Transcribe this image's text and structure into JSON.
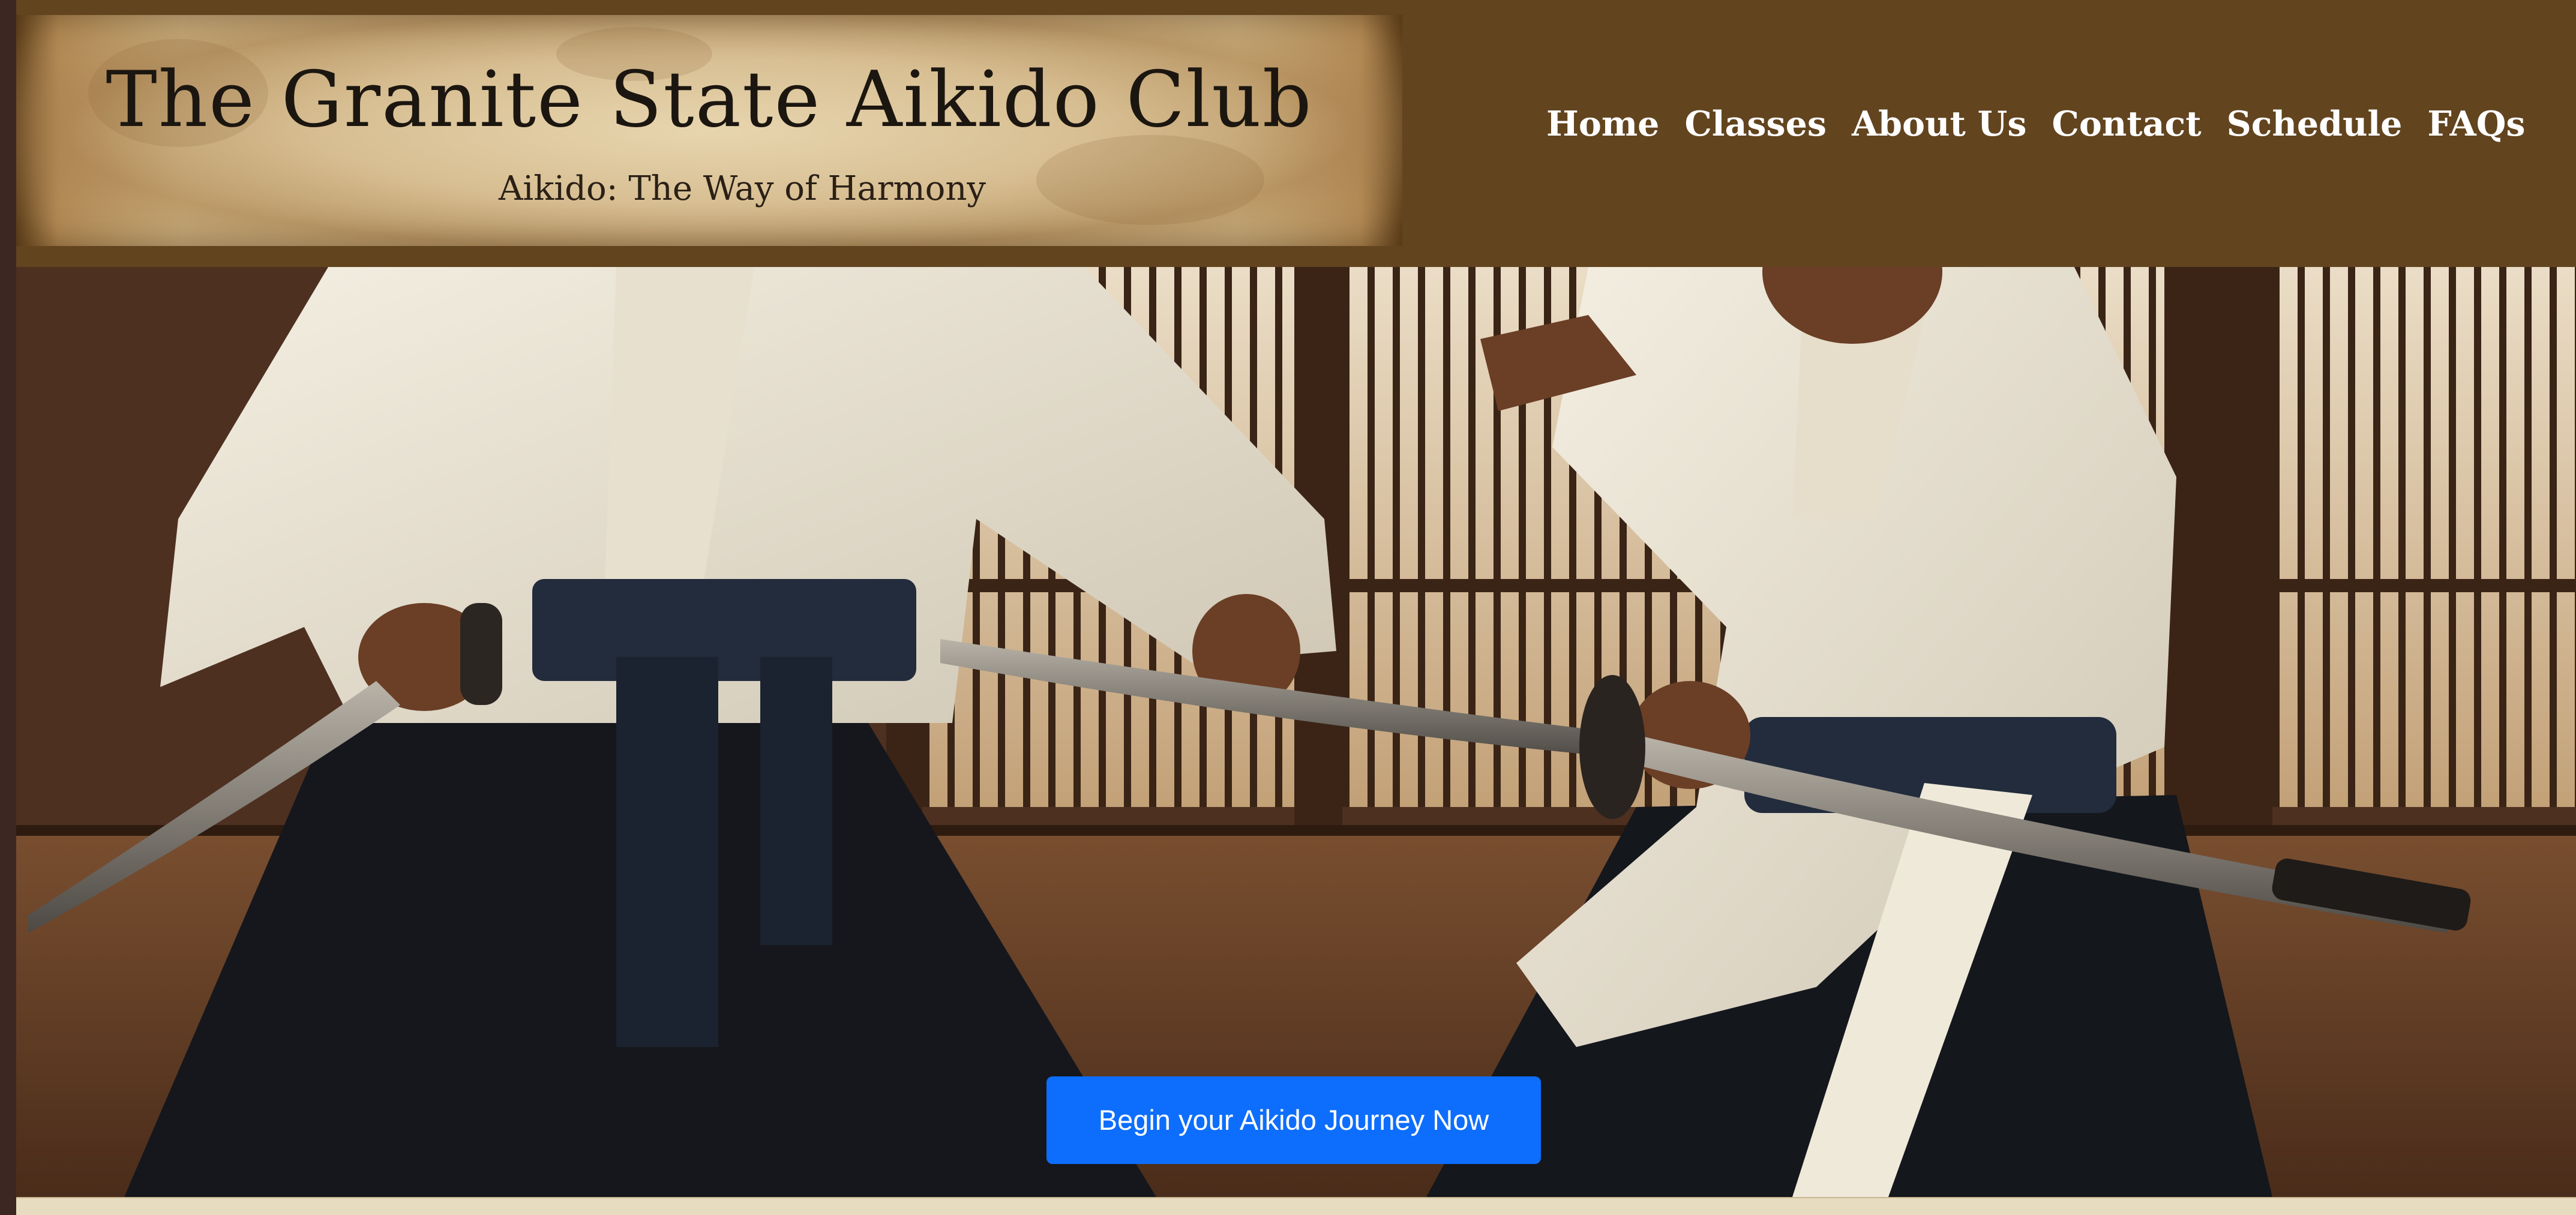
{
  "header": {
    "logo_title": "The Granite State Aikido Club",
    "logo_subtitle": "Aikido: The Way of Harmony",
    "background_color": "#62441f"
  },
  "nav": {
    "items": [
      {
        "label": "Home"
      },
      {
        "label": "Classes"
      },
      {
        "label": "About Us"
      },
      {
        "label": "Contact"
      },
      {
        "label": "Schedule"
      },
      {
        "label": "FAQs"
      }
    ]
  },
  "hero": {
    "image_alt": "Two aikido practitioners in white gi and dark hakama training with swords in a dojo",
    "cta_label": "Begin your Aikido Journey Now",
    "cta_color": "#0d6efd"
  }
}
